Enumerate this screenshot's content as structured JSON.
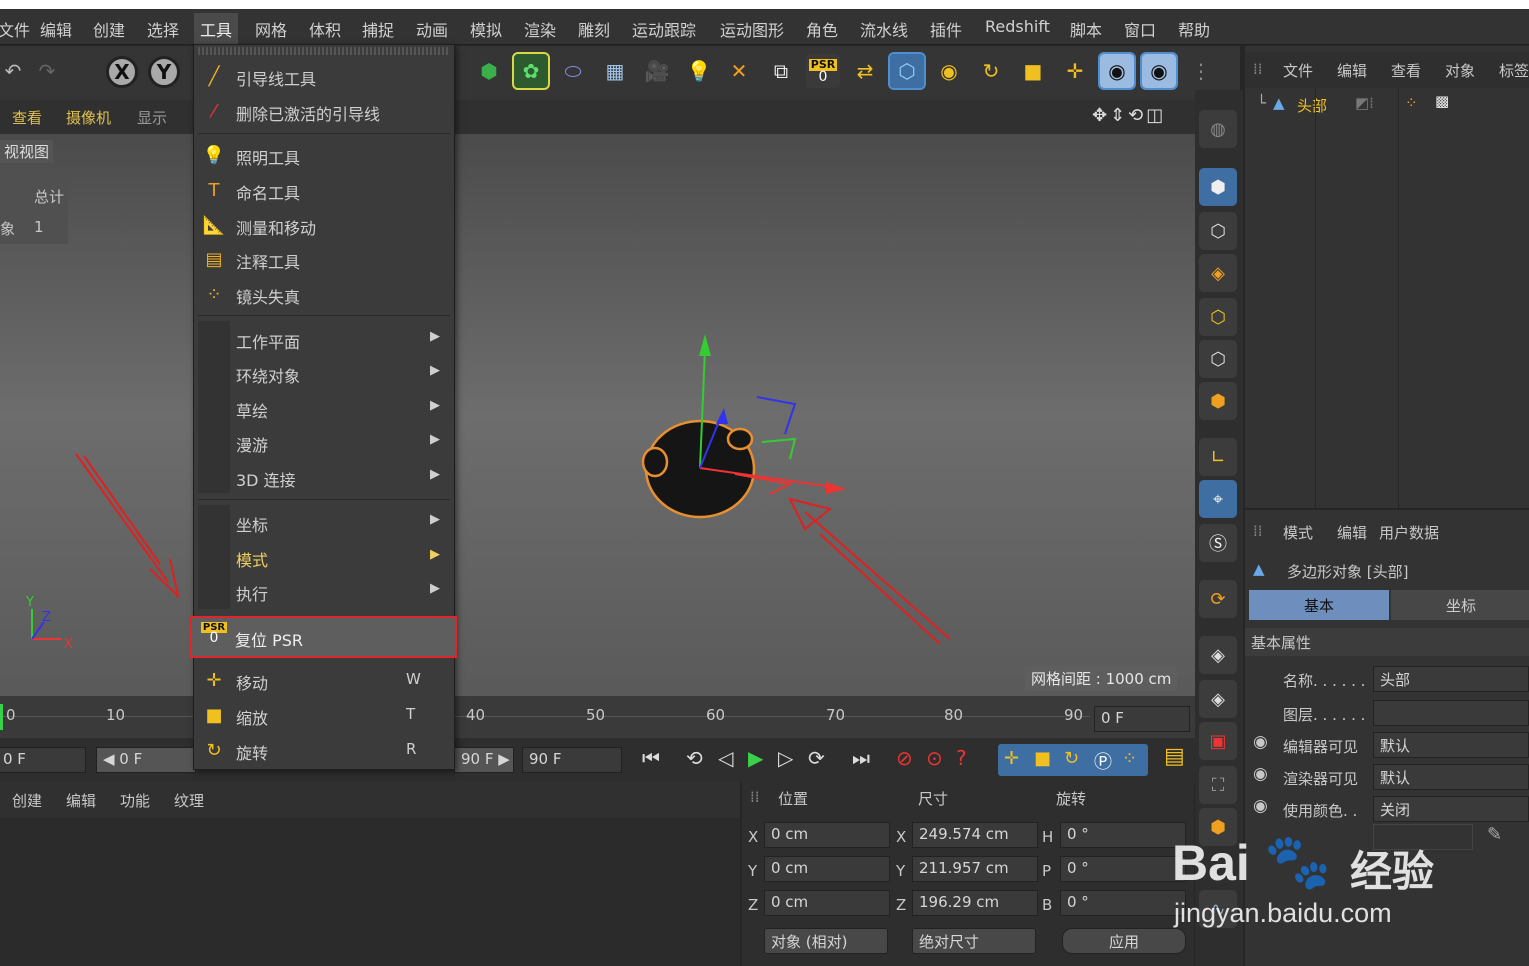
{
  "menubar": {
    "items": [
      "文件",
      "编辑",
      "创建",
      "选择",
      "工具",
      "网格",
      "体积",
      "捕捉",
      "动画",
      "模拟",
      "渲染",
      "雕刻",
      "运动跟踪",
      "运动图形",
      "角色",
      "流水线",
      "插件",
      "Redshift",
      "脚本",
      "窗口",
      "帮助"
    ]
  },
  "toolbar": {
    "x_label": "X",
    "y_label": "Y",
    "psr_label": "PSR",
    "psr_value": "0"
  },
  "viewport": {
    "tabs": [
      "查看",
      "摄像机",
      "显示"
    ],
    "view_label": "视视图",
    "stats_total": "总计",
    "stats_obj": "象",
    "stats_count": "1",
    "grid_spacing": "网格间距 : 1000 cm"
  },
  "tools_menu": {
    "items": [
      {
        "label": "引导线工具",
        "icon": "guide-icon"
      },
      {
        "label": "删除已激活的引导线",
        "icon": "delete-guide-icon"
      },
      {
        "label": "照明工具",
        "icon": "light-tool-icon"
      },
      {
        "label": "命名工具",
        "icon": "naming-tool-icon"
      },
      {
        "label": "测量和移动",
        "icon": "measure-icon"
      },
      {
        "label": "注释工具",
        "icon": "annotation-icon"
      },
      {
        "label": "镜头失真",
        "icon": "lens-distort-icon"
      }
    ],
    "submenus": [
      "工作平面",
      "环绕对象",
      "草绘",
      "漫游",
      "3D 连接"
    ],
    "submenus2": [
      "坐标",
      "模式",
      "执行"
    ],
    "reset_psr": "复位 PSR",
    "reset_psr_icon_top": "PSR",
    "reset_psr_icon_bottom": "0",
    "transform": [
      {
        "label": "移动",
        "shortcut": "W",
        "icon": "move-icon"
      },
      {
        "label": "缩放",
        "shortcut": "T",
        "icon": "scale-icon"
      },
      {
        "label": "旋转",
        "shortcut": "R",
        "icon": "rotate-icon"
      }
    ]
  },
  "timeline": {
    "ticks": [
      "0",
      "10",
      "40",
      "50",
      "60",
      "70",
      "80",
      "90"
    ],
    "frame_field": "0 F"
  },
  "transport": {
    "start": "0 F",
    "left": "◀ 0 F",
    "end1": "90 F ▶",
    "end2": "90 F"
  },
  "material_manager": {
    "menu": [
      "创建",
      "编辑",
      "功能",
      "纹理"
    ]
  },
  "coords": {
    "headers": [
      "位置",
      "尺寸",
      "旋转"
    ],
    "rows": [
      {
        "axis": "X",
        "pos": "0 cm",
        "size_axis": "X",
        "size": "249.574 cm",
        "rot_axis": "H",
        "rot": "0 °"
      },
      {
        "axis": "Y",
        "pos": "0 cm",
        "size_axis": "Y",
        "size": "211.957 cm",
        "rot_axis": "P",
        "rot": "0 °"
      },
      {
        "axis": "Z",
        "pos": "0 cm",
        "size_axis": "Z",
        "size": "196.29 cm",
        "rot_axis": "B",
        "rot": "0 °"
      }
    ],
    "mode1": "对象 (相对)",
    "mode2": "绝对尺寸",
    "apply": "应用"
  },
  "object_manager": {
    "menu": [
      "文件",
      "编辑",
      "查看",
      "对象",
      "标签"
    ],
    "object_name": "头部"
  },
  "attributes": {
    "menu": [
      "模式",
      "编辑",
      "用户数据"
    ],
    "title": "多边形对象 [头部]",
    "tabs": [
      "基本",
      "坐标"
    ],
    "section": "基本属性",
    "fields": [
      {
        "label": "名称. . . . . .",
        "value": "头部"
      },
      {
        "label": "图层. . . . . .",
        "value": ""
      },
      {
        "label": "编辑器可见",
        "value": "默认"
      },
      {
        "label": "渲染器可见",
        "value": "默认"
      },
      {
        "label": "使用颜色. .",
        "value": "关闭"
      }
    ]
  },
  "watermark": {
    "brand": "Bai",
    "brand2": "经验",
    "url": "jingyan.baidu.com"
  },
  "colors": {
    "accent": "#3f6ea3",
    "highlight_border": "#e0262a",
    "object_orange": "#e89030"
  }
}
